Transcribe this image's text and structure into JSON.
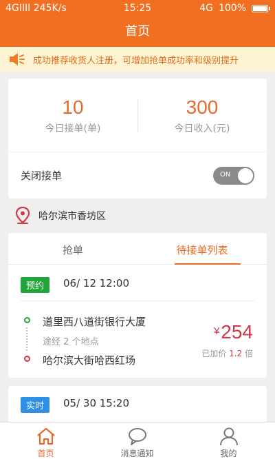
{
  "status_bar": {
    "left": "4GΙΙΙΙ 245K/s",
    "time": "15:25",
    "network": "4G",
    "battery": "100%"
  },
  "nav": {
    "title": "首页"
  },
  "notice": {
    "text": "成功推荐收货人注册，可增加抢单成功率和级别提升"
  },
  "stats": {
    "today_orders": {
      "value": "10",
      "label": "今日接单(单)"
    },
    "today_income": {
      "value": "300",
      "label": "今日收入(元)"
    },
    "close_label": "关闭接单",
    "toggle_label": "ON"
  },
  "location": {
    "text": "哈尔滨市香坊区"
  },
  "tabs": [
    {
      "label": "抢单",
      "active": false
    },
    {
      "label": "待接单列表",
      "active": true
    }
  ],
  "orders": [
    {
      "badge": "预约",
      "time": "06/ 12 12:00",
      "from": "道里西八道街银行大厦",
      "via": "途经 2 个地点",
      "to": "哈尔滨大街哈西红场",
      "currency": "¥",
      "price": "254",
      "markup_prefix": "已加价",
      "markup_value": "1.2",
      "markup_suffix": "倍"
    },
    {
      "badge": "实时",
      "time": "05/ 30 15:20"
    }
  ],
  "bottom_nav": [
    {
      "label": "首页",
      "icon": "home-icon",
      "active": true
    },
    {
      "label": "消息通知",
      "icon": "chat-icon",
      "active": false
    },
    {
      "label": "我的",
      "icon": "user-icon",
      "active": false
    }
  ],
  "colors": {
    "brand": "#f26f21",
    "price_red": "#d0374b",
    "badge_green": "#1fa53b",
    "badge_blue": "#2d8fe6"
  }
}
